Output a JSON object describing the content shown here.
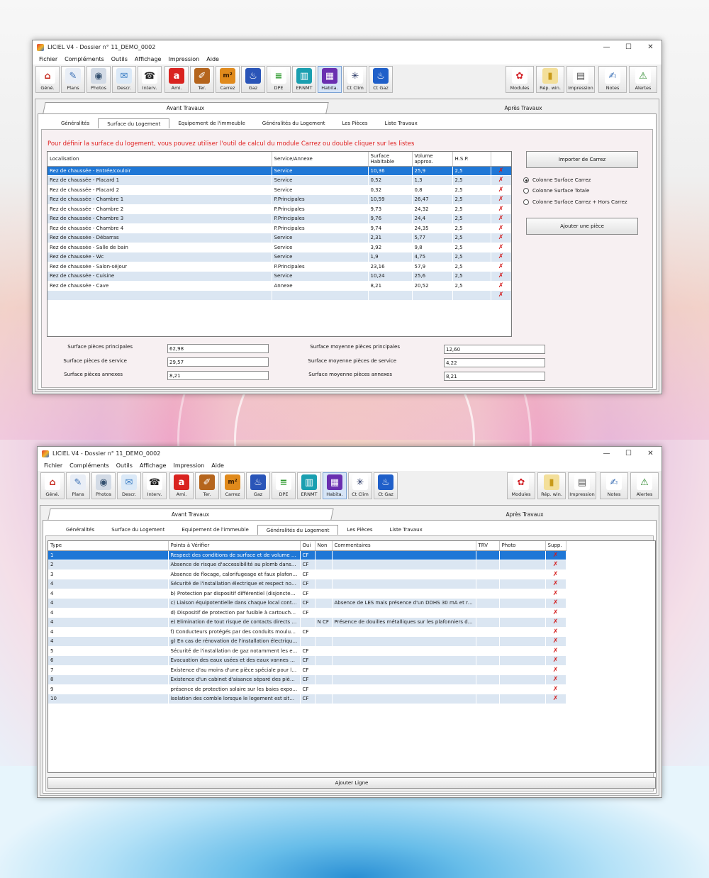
{
  "colors": {
    "accent": "#1f77d6",
    "note_red": "#e02020",
    "row_alt": "#dbe6f2",
    "delete": "#d31a1a"
  },
  "window1": {
    "title": "LICIEL V4 - Dossier n° 11_DEMO_0002",
    "controls": [
      "—",
      "☐",
      "✕"
    ],
    "menu": [
      "Fichier",
      "Compléments",
      "Outils",
      "Affichage",
      "Impression",
      "Aide"
    ],
    "toolbar_left": [
      {
        "label": "Géné.",
        "icon": "house-icon"
      },
      {
        "label": "Plans",
        "icon": "plans-icon"
      },
      {
        "label": "Photos",
        "icon": "camera-icon"
      },
      {
        "label": "Descr.",
        "icon": "description-icon"
      },
      {
        "label": "Interv.",
        "icon": "phone-icon"
      },
      {
        "label": "Ami.",
        "icon": "amiante-icon"
      },
      {
        "label": "Ter.",
        "icon": "termites-icon"
      },
      {
        "label": "Carrez",
        "icon": "carrez-icon"
      },
      {
        "label": "Gaz",
        "icon": "gas-flame-icon"
      },
      {
        "label": "DPE",
        "icon": "dpe-icon"
      },
      {
        "label": "ERNMT",
        "icon": "factory-icon"
      },
      {
        "label": "Habita.",
        "icon": "calculator-icon"
      },
      {
        "label": "Ct Clim",
        "icon": "snowflake-icon"
      },
      {
        "label": "Ct Gaz",
        "icon": "gas-check-icon"
      }
    ],
    "toolbar_right": [
      {
        "label": "Modules",
        "icon": "modules-icon"
      },
      {
        "label": "Rép. win.",
        "icon": "folder-icon"
      },
      {
        "label": "Impression",
        "icon": "printer-icon"
      },
      {
        "label": "Notes",
        "icon": "notes-icon"
      },
      {
        "label": "Alertes",
        "icon": "alert-icon"
      }
    ],
    "outer_tabs": [
      "Avant Travaux",
      "Après Travaux"
    ],
    "inner_tabs": [
      "Généralités",
      "Surface du Logement",
      "Equipement de l'immeuble",
      "Généralités du Logement",
      "Les Pièces",
      "Liste Travaux"
    ],
    "note": "Pour définir la surface du logement, vous pouvez utiliser l'outil de calcul du module Carrez ou double cliquer sur les listes",
    "table": {
      "headers": [
        "Localisation",
        "Service/Annexe",
        "Surface Habitable",
        "Volume approx.",
        "H.S.P."
      ],
      "rows": [
        [
          "Rez de chaussée - Entrée/couloir",
          "Service",
          "10,36",
          "25,9",
          "2,5"
        ],
        [
          "Rez de chaussée - Placard  1",
          "Service",
          "0,52",
          "1,3",
          "2,5"
        ],
        [
          "Rez de chaussée - Placard  2",
          "Service",
          "0,32",
          "0,8",
          "2,5"
        ],
        [
          "Rez de chaussée - Chambre  1",
          "P.Principales",
          "10,59",
          "26,47",
          "2,5"
        ],
        [
          "Rez de chaussée - Chambre  2",
          "P.Principales",
          "9,73",
          "24,32",
          "2,5"
        ],
        [
          "Rez de chaussée - Chambre  3",
          "P.Principales",
          "9,76",
          "24,4",
          "2,5"
        ],
        [
          "Rez de chaussée - Chambre  4",
          "P.Principales",
          "9,74",
          "24,35",
          "2,5"
        ],
        [
          "Rez de chaussée - Débarras",
          "Service",
          "2,31",
          "5,77",
          "2,5"
        ],
        [
          "Rez de chaussée - Salle de bain",
          "Service",
          "3,92",
          "9,8",
          "2,5"
        ],
        [
          "Rez de chaussée - Wc",
          "Service",
          "1,9",
          "4,75",
          "2,5"
        ],
        [
          "Rez de chaussée - Salon-séjour",
          "P.Principales",
          "23,16",
          "57,9",
          "2,5"
        ],
        [
          "Rez de chaussée - Cuisine",
          "Service",
          "10,24",
          "25,6",
          "2,5"
        ],
        [
          "Rez de chaussée - Cave",
          "Annexe",
          "8,21",
          "20,52",
          "2,5"
        ],
        [
          "",
          "",
          "",
          "",
          ""
        ]
      ]
    },
    "import_button": "Importer de Carrez",
    "radios": [
      "Colonne Surface Carrez",
      "Colonne Surface Totale",
      "Colonne Surface Carrez + Hors Carrez"
    ],
    "add_room_button": "Ajouter une pièce",
    "summary": {
      "principal_label": "Surface pièces principales",
      "principal_value": "62,98",
      "service_label": "Surface pièces de service",
      "service_value": "29,57",
      "annex_label": "Surface pièces annexes",
      "annex_value": "8,21",
      "avg_principal_label": "Surface moyenne pièces principales",
      "avg_principal_value": "12,60",
      "avg_service_label": "Surface moyenne pièces de service",
      "avg_service_value": "4,22",
      "avg_annex_label": "Surface moyenne pièces annexes",
      "avg_annex_value": "8,21"
    }
  },
  "window2": {
    "title": "LICIEL V4 - Dossier n° 11_DEMO_0002",
    "outer_tabs": [
      "Avant Travaux",
      "Après Travaux"
    ],
    "inner_tabs": [
      "Généralités",
      "Surface du Logement",
      "Equipement de l'immeuble",
      "Généralités du Logement",
      "Les Pièces",
      "Liste Travaux"
    ],
    "table": {
      "headers": [
        "Type",
        "Points à Vérifier",
        "Oui",
        "Non",
        "Commentaires",
        "TRV",
        "Photo",
        "Supp."
      ],
      "rows": [
        [
          "1",
          "Respect des conditions de surface et de volume ha...",
          "CF",
          "",
          "",
          "",
          ""
        ],
        [
          "2",
          "Absence de risque d'accessibilité au plomb dans le...",
          "CF",
          "",
          "",
          "",
          ""
        ],
        [
          "3",
          "Absence de flocage, calorifugeage et faux plafond...",
          "CF",
          "",
          "",
          "",
          ""
        ],
        [
          "4",
          "Sécurité de l'installation électrique et respect nota...",
          "CF",
          "",
          "",
          "",
          ""
        ],
        [
          "4",
          "b) Protection par dispositif différentiel (disjoncteur...",
          "CF",
          "",
          "",
          "",
          ""
        ],
        [
          "4",
          "c) Liaison équipotentielle dans chaque local conte...",
          "CF",
          "",
          "Absence de LES mais présence d'un DDHS 30 mA et rési...",
          "",
          ""
        ],
        [
          "4",
          "d) Dispositif de protection par fusible à cartouche ...",
          "CF",
          "",
          "",
          "",
          ""
        ],
        [
          "4",
          "e) Elimination de tout risque de contacts directs av...",
          "",
          "N CF",
          "Présence de douilles métalliques sur les plafonniers de...",
          "",
          ""
        ],
        [
          "4",
          "f) Conducteurs protégés par des conduits moulure...",
          "CF",
          "",
          "",
          "",
          ""
        ],
        [
          "4",
          "g) En cas de rénovation de l'installation électrique ...",
          "",
          "",
          "",
          "",
          ""
        ],
        [
          "5",
          "Sécurité de l'installation de gaz notamment les exi...",
          "CF",
          "",
          "",
          "",
          ""
        ],
        [
          "6",
          "Evacuation des eaux usées et des eaux vannes avec...",
          "CF",
          "",
          "",
          "",
          ""
        ],
        [
          "7",
          "Existence d'au moins d'une pièce spéciale pour les...",
          "CF",
          "",
          "",
          "",
          ""
        ],
        [
          "8",
          "Existence d'un cabinet d'aisance séparé des pièces...",
          "CF",
          "",
          "",
          "",
          ""
        ],
        [
          "9",
          "présence de protection solaire sur les baies exposé...",
          "CF",
          "",
          "",
          "",
          ""
        ],
        [
          "10",
          "Isolation des comble lorsque le logement est situé ...",
          "CF",
          "",
          "",
          "",
          ""
        ]
      ]
    },
    "add_line_button": "Ajouter Ligne"
  }
}
